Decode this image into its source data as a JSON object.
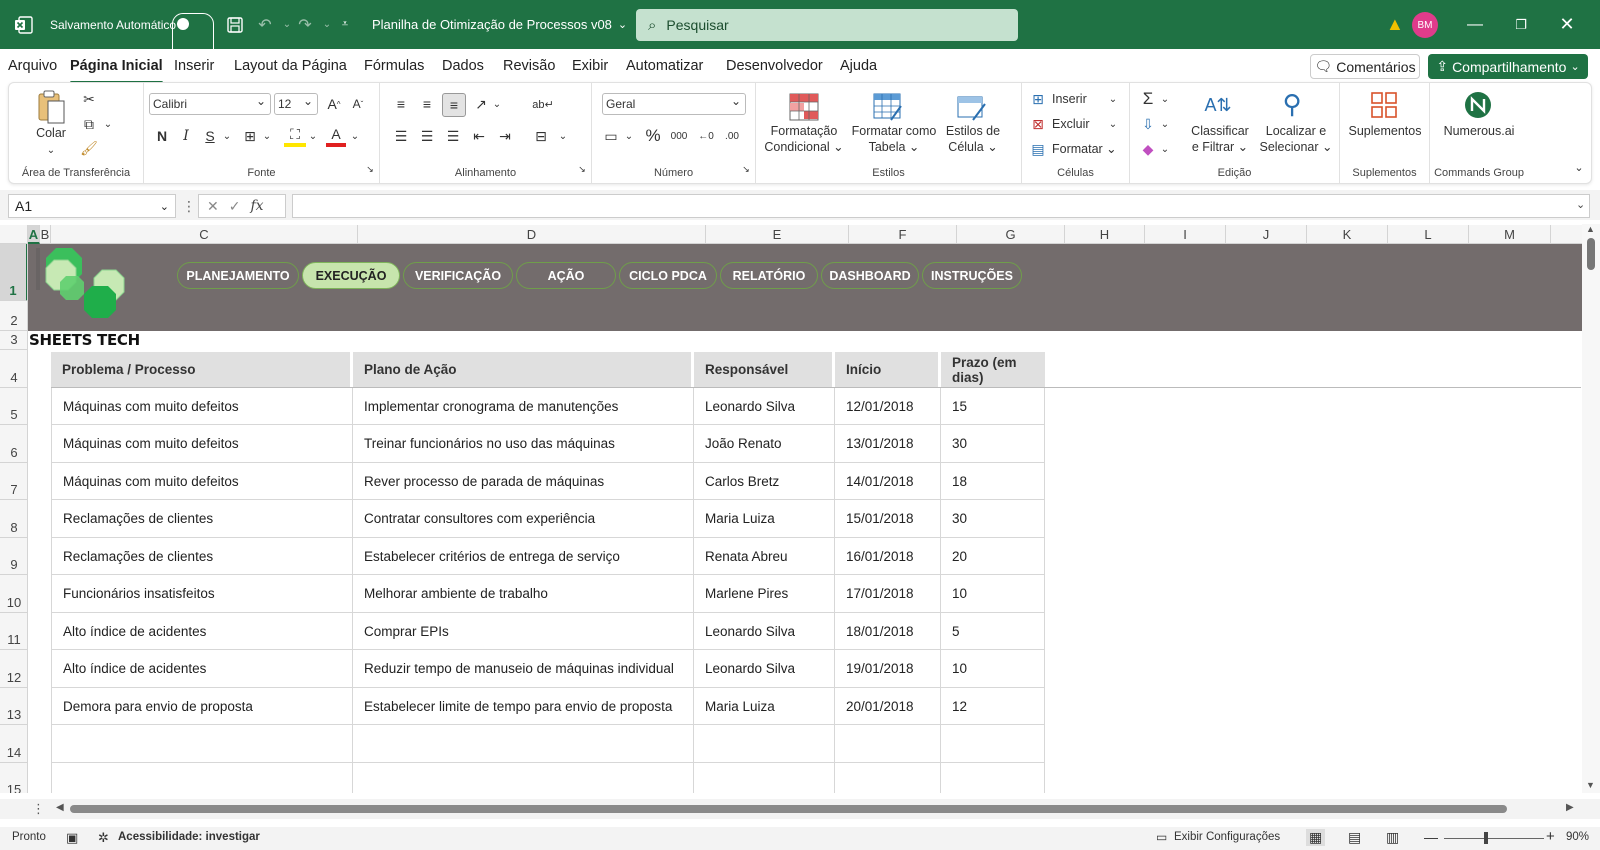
{
  "titlebar": {
    "autosave_label": "Salvamento Automático",
    "doc_title": "Planilha de Otimização de Processos v08",
    "search_placeholder": "Pesquisar",
    "avatar_initials": "BM"
  },
  "menu": {
    "items": [
      "Arquivo",
      "Página Inicial",
      "Inserir",
      "Layout da Página",
      "Fórmulas",
      "Dados",
      "Revisão",
      "Exibir",
      "Automatizar",
      "Desenvolvedor",
      "Ajuda"
    ],
    "comments": "Comentários",
    "share": "Compartilhamento"
  },
  "ribbon": {
    "clipboard": {
      "paste": "Colar",
      "label": "Área de Transferência"
    },
    "font": {
      "name": "Calibri",
      "size": "12",
      "label": "Fonte"
    },
    "alignment": {
      "label": "Alinhamento"
    },
    "number": {
      "format": "Geral",
      "label": "Número"
    },
    "styles": {
      "cond_l1": "Formatação",
      "cond_l2": "Condicional",
      "table_l1": "Formatar como",
      "table_l2": "Tabela",
      "cell_l1": "Estilos de",
      "cell_l2": "Célula",
      "label": "Estilos"
    },
    "cells": {
      "insert": "Inserir",
      "delete": "Excluir",
      "format": "Formatar",
      "label": "Células"
    },
    "editing": {
      "sort_l1": "Classificar",
      "sort_l2": "e Filtrar",
      "find_l1": "Localizar e",
      "find_l2": "Selecionar",
      "label": "Edição"
    },
    "addins": {
      "btn": "Suplementos",
      "label": "Suplementos"
    },
    "commands": {
      "btn": "Numerous.ai",
      "label": "Commands Group"
    },
    "accent_color": "#1f7244"
  },
  "formula_bar": {
    "name_box": "A1",
    "fx": "fx",
    "content": ""
  },
  "columns": [
    "A",
    "B",
    "C",
    "D",
    "E",
    "F",
    "G",
    "H",
    "I",
    "J",
    "K",
    "L",
    "M"
  ],
  "rows": [
    "1",
    "2",
    "3",
    "4",
    "5",
    "6",
    "7",
    "8",
    "9",
    "10",
    "11",
    "12",
    "13",
    "14",
    "15"
  ],
  "nav_buttons": [
    "PLANEJAMENTO",
    "EXECUÇÃO",
    "VERIFICAÇÃO",
    "AÇÃO",
    "CICLO PDCA",
    "RELATÓRIO",
    "DASHBOARD",
    "INSTRUÇÕES"
  ],
  "brand": "SHEETS TECH",
  "table": {
    "headers": [
      "Problema / Processo",
      "Plano de Ação",
      "Responsável",
      "Início",
      "Prazo (em dias)"
    ],
    "rows": [
      [
        "Máquinas com muito defeitos",
        "Implementar cronograma de manutenções",
        "Leonardo Silva",
        "12/01/2018",
        "15"
      ],
      [
        "Máquinas com muito defeitos",
        "Treinar funcionários no uso das máquinas",
        "João Renato",
        "13/01/2018",
        "30"
      ],
      [
        "Máquinas com muito defeitos",
        "Rever processo de parada de máquinas",
        "Carlos Bretz",
        "14/01/2018",
        "18"
      ],
      [
        "Reclamações de clientes",
        "Contratar consultores com experiência",
        "Maria Luiza",
        "15/01/2018",
        "30"
      ],
      [
        "Reclamações de clientes",
        "Estabelecer critérios de entrega de serviço",
        "Renata Abreu",
        "16/01/2018",
        "20"
      ],
      [
        "Funcionários insatisfeitos",
        "Melhorar ambiente de trabalho",
        "Marlene Pires",
        "17/01/2018",
        "10"
      ],
      [
        "Alto índice de acidentes",
        "Comprar EPIs",
        "Leonardo Silva",
        "18/01/2018",
        "5"
      ],
      [
        "Alto índice de acidentes",
        "Reduzir tempo de manuseio de máquinas individual",
        "Leonardo Silva",
        "19/01/2018",
        "10"
      ],
      [
        "Demora para envio de proposta",
        "Estabelecer limite de tempo para envio de proposta",
        "Maria Luiza",
        "20/01/2018",
        "12"
      ],
      [
        "",
        "",
        "",
        "",
        ""
      ],
      [
        "",
        "",
        "",
        "",
        ""
      ]
    ]
  },
  "status": {
    "ready": "Pronto",
    "accessibility": "Acessibilidade: investigar",
    "display_settings": "Exibir Configurações",
    "zoom": "90%"
  }
}
